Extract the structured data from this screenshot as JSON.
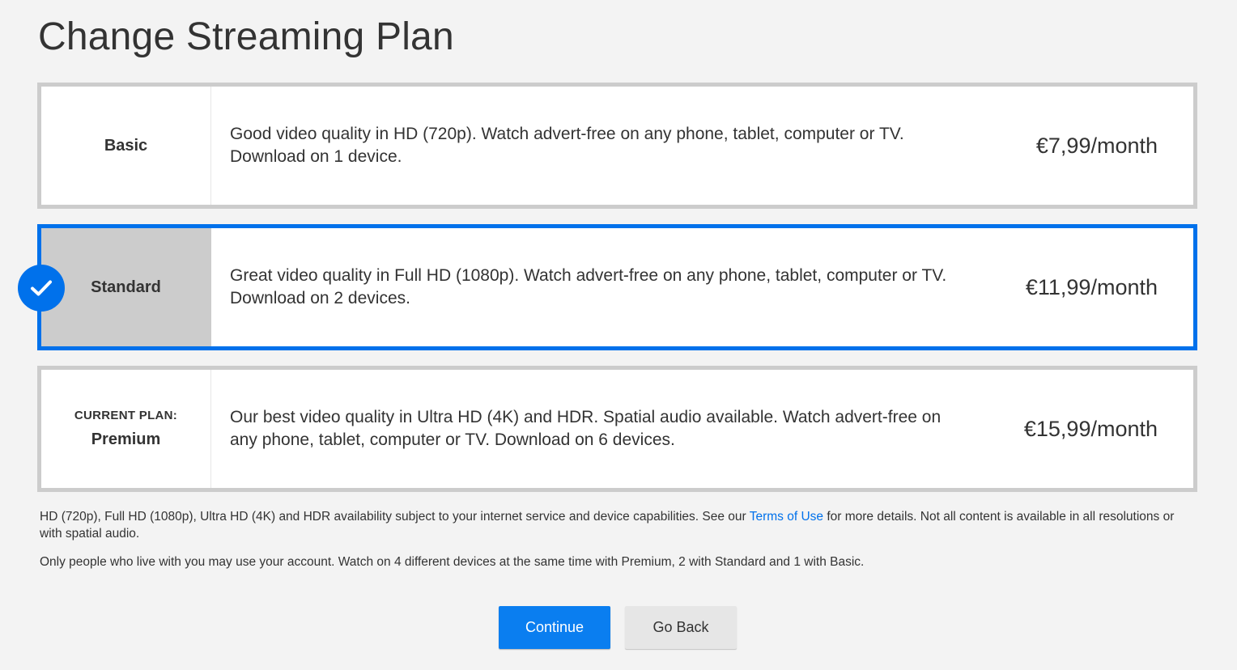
{
  "page": {
    "title": "Change Streaming Plan"
  },
  "plans": [
    {
      "name": "Basic",
      "current_label": "",
      "description": "Good video quality in HD (720p). Watch advert-free on any phone, tablet, computer or TV. Download on 1 device.",
      "price": "€7,99/month",
      "selected": false
    },
    {
      "name": "Standard",
      "current_label": "",
      "description": "Great video quality in Full HD (1080p). Watch advert-free on any phone, tablet, computer or TV. Download on 2 devices.",
      "price": "€11,99/month",
      "selected": true
    },
    {
      "name": "Premium",
      "current_label": "CURRENT PLAN:",
      "description": "Our best video quality in Ultra HD (4K) and HDR. Spatial audio available. Watch advert-free on any phone, tablet, computer or TV. Download on 6 devices.",
      "price": "€15,99/month",
      "selected": false
    }
  ],
  "disclaimer": {
    "line1_before": "HD (720p), Full HD (1080p), Ultra HD (4K) and HDR availability subject to your internet service and device capabilities. See our ",
    "terms_link": "Terms of Use",
    "line1_after": " for more details. Not all content is available in all resolutions or with spatial audio.",
    "line2": "Only people who live with you may use your account. Watch on 4 different devices at the same time with Premium, 2 with Standard and 1 with Basic."
  },
  "actions": {
    "continue_label": "Continue",
    "back_label": "Go Back"
  },
  "icons": {
    "selected_check": "check-icon"
  },
  "colors": {
    "accent": "#0071eb",
    "card_border": "#cccccc",
    "selected_name_bg": "#cccccc",
    "background": "#f3f3f3"
  }
}
